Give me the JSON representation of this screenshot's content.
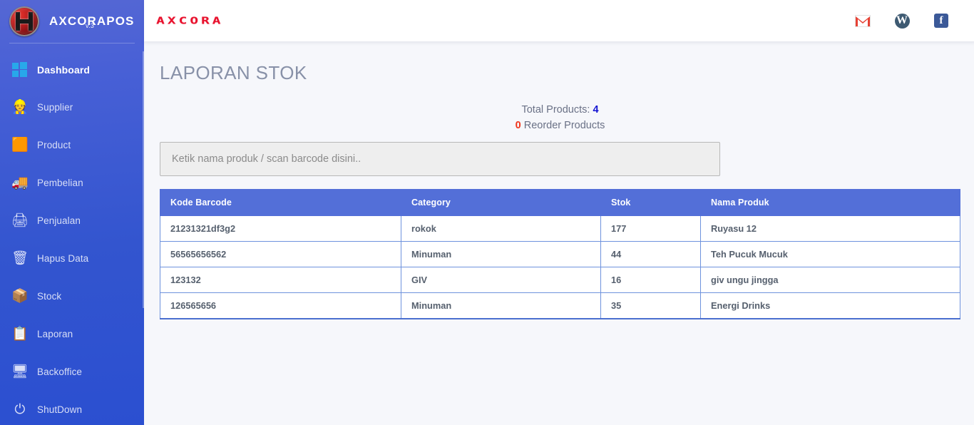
{
  "sidebar": {
    "brand": {
      "title": "AXCORAPOS",
      "version": "v.3",
      "logo_icon": "axcora-badge-icon"
    },
    "items": [
      {
        "label": "Dashboard",
        "icon": "windows-flag-icon",
        "active": true
      },
      {
        "label": "Supplier",
        "icon": "supplier-worker-icon",
        "active": false
      },
      {
        "label": "Product",
        "icon": "orange-box-icon",
        "active": false
      },
      {
        "label": "Pembelian",
        "icon": "delivery-truck-icon",
        "active": false
      },
      {
        "label": "Penjualan",
        "icon": "cash-register-icon",
        "active": false
      },
      {
        "label": "Hapus Data",
        "icon": "trash-bin-icon",
        "active": false
      },
      {
        "label": "Stock",
        "icon": "package-box-icon",
        "active": false
      },
      {
        "label": "Laporan",
        "icon": "clipboard-calculator-icon",
        "active": false
      },
      {
        "label": "Backoffice",
        "icon": "desktop-monitor-icon",
        "active": false
      },
      {
        "label": "ShutDown",
        "icon": "power-off-icon",
        "active": false
      }
    ]
  },
  "topbar": {
    "logo_text": "AXCORA",
    "icons": [
      {
        "name": "gmail-icon",
        "label": "M"
      },
      {
        "name": "wordpress-icon",
        "label": "W"
      },
      {
        "name": "facebook-icon",
        "label": "f"
      }
    ]
  },
  "page": {
    "title": "LAPORAN STOK",
    "total_products_label": "Total Products:",
    "total_products_value": "4",
    "reorder_value": "0",
    "reorder_label": "Reorder Products"
  },
  "search": {
    "placeholder": "Ketik nama produk / scan barcode disini..",
    "value": ""
  },
  "table": {
    "columns": [
      "Kode Barcode",
      "Category",
      "Stok",
      "Nama Produk"
    ],
    "rows": [
      {
        "kode": "21231321df3g2",
        "category": "rokok",
        "stok": "177",
        "nama": "Ruyasu 12"
      },
      {
        "kode": "56565656562",
        "category": "Minuman",
        "stok": "44",
        "nama": "Teh Pucuk Mucuk"
      },
      {
        "kode": "123132",
        "category": "GIV",
        "stok": "16",
        "nama": "giv ungu jingga"
      },
      {
        "kode": "126565656",
        "category": "Minuman",
        "stok": "35",
        "nama": "Energi Drinks"
      }
    ]
  },
  "colors": {
    "sidebar_top": "#5567d4",
    "sidebar_bottom": "#2b4fd0",
    "table_header": "#536fd8",
    "table_border": "#6e92dd",
    "accent_red": "#e8112d",
    "total_blue": "#1414d2",
    "reorder_red": "#f0351b",
    "page_bg": "#f6f7fb"
  }
}
